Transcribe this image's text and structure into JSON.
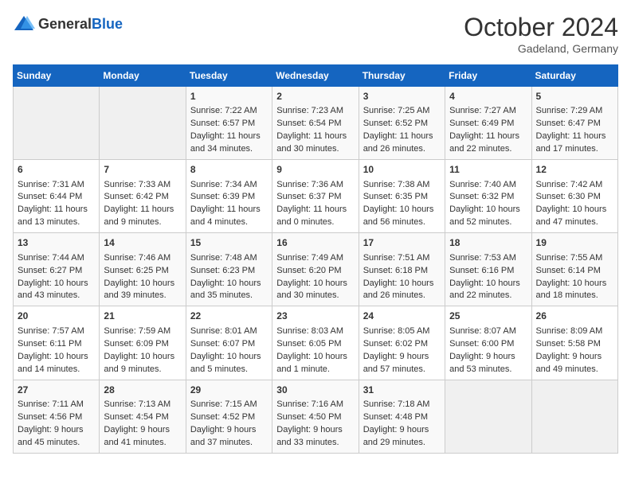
{
  "header": {
    "logo_general": "General",
    "logo_blue": "Blue",
    "month": "October 2024",
    "location": "Gadeland, Germany"
  },
  "weekdays": [
    "Sunday",
    "Monday",
    "Tuesday",
    "Wednesday",
    "Thursday",
    "Friday",
    "Saturday"
  ],
  "weeks": [
    [
      {
        "day": "",
        "empty": true
      },
      {
        "day": "",
        "empty": true
      },
      {
        "day": "1",
        "sunrise": "Sunrise: 7:22 AM",
        "sunset": "Sunset: 6:57 PM",
        "daylight": "Daylight: 11 hours and 34 minutes."
      },
      {
        "day": "2",
        "sunrise": "Sunrise: 7:23 AM",
        "sunset": "Sunset: 6:54 PM",
        "daylight": "Daylight: 11 hours and 30 minutes."
      },
      {
        "day": "3",
        "sunrise": "Sunrise: 7:25 AM",
        "sunset": "Sunset: 6:52 PM",
        "daylight": "Daylight: 11 hours and 26 minutes."
      },
      {
        "day": "4",
        "sunrise": "Sunrise: 7:27 AM",
        "sunset": "Sunset: 6:49 PM",
        "daylight": "Daylight: 11 hours and 22 minutes."
      },
      {
        "day": "5",
        "sunrise": "Sunrise: 7:29 AM",
        "sunset": "Sunset: 6:47 PM",
        "daylight": "Daylight: 11 hours and 17 minutes."
      }
    ],
    [
      {
        "day": "6",
        "sunrise": "Sunrise: 7:31 AM",
        "sunset": "Sunset: 6:44 PM",
        "daylight": "Daylight: 11 hours and 13 minutes."
      },
      {
        "day": "7",
        "sunrise": "Sunrise: 7:33 AM",
        "sunset": "Sunset: 6:42 PM",
        "daylight": "Daylight: 11 hours and 9 minutes."
      },
      {
        "day": "8",
        "sunrise": "Sunrise: 7:34 AM",
        "sunset": "Sunset: 6:39 PM",
        "daylight": "Daylight: 11 hours and 4 minutes."
      },
      {
        "day": "9",
        "sunrise": "Sunrise: 7:36 AM",
        "sunset": "Sunset: 6:37 PM",
        "daylight": "Daylight: 11 hours and 0 minutes."
      },
      {
        "day": "10",
        "sunrise": "Sunrise: 7:38 AM",
        "sunset": "Sunset: 6:35 PM",
        "daylight": "Daylight: 10 hours and 56 minutes."
      },
      {
        "day": "11",
        "sunrise": "Sunrise: 7:40 AM",
        "sunset": "Sunset: 6:32 PM",
        "daylight": "Daylight: 10 hours and 52 minutes."
      },
      {
        "day": "12",
        "sunrise": "Sunrise: 7:42 AM",
        "sunset": "Sunset: 6:30 PM",
        "daylight": "Daylight: 10 hours and 47 minutes."
      }
    ],
    [
      {
        "day": "13",
        "sunrise": "Sunrise: 7:44 AM",
        "sunset": "Sunset: 6:27 PM",
        "daylight": "Daylight: 10 hours and 43 minutes."
      },
      {
        "day": "14",
        "sunrise": "Sunrise: 7:46 AM",
        "sunset": "Sunset: 6:25 PM",
        "daylight": "Daylight: 10 hours and 39 minutes."
      },
      {
        "day": "15",
        "sunrise": "Sunrise: 7:48 AM",
        "sunset": "Sunset: 6:23 PM",
        "daylight": "Daylight: 10 hours and 35 minutes."
      },
      {
        "day": "16",
        "sunrise": "Sunrise: 7:49 AM",
        "sunset": "Sunset: 6:20 PM",
        "daylight": "Daylight: 10 hours and 30 minutes."
      },
      {
        "day": "17",
        "sunrise": "Sunrise: 7:51 AM",
        "sunset": "Sunset: 6:18 PM",
        "daylight": "Daylight: 10 hours and 26 minutes."
      },
      {
        "day": "18",
        "sunrise": "Sunrise: 7:53 AM",
        "sunset": "Sunset: 6:16 PM",
        "daylight": "Daylight: 10 hours and 22 minutes."
      },
      {
        "day": "19",
        "sunrise": "Sunrise: 7:55 AM",
        "sunset": "Sunset: 6:14 PM",
        "daylight": "Daylight: 10 hours and 18 minutes."
      }
    ],
    [
      {
        "day": "20",
        "sunrise": "Sunrise: 7:57 AM",
        "sunset": "Sunset: 6:11 PM",
        "daylight": "Daylight: 10 hours and 14 minutes."
      },
      {
        "day": "21",
        "sunrise": "Sunrise: 7:59 AM",
        "sunset": "Sunset: 6:09 PM",
        "daylight": "Daylight: 10 hours and 9 minutes."
      },
      {
        "day": "22",
        "sunrise": "Sunrise: 8:01 AM",
        "sunset": "Sunset: 6:07 PM",
        "daylight": "Daylight: 10 hours and 5 minutes."
      },
      {
        "day": "23",
        "sunrise": "Sunrise: 8:03 AM",
        "sunset": "Sunset: 6:05 PM",
        "daylight": "Daylight: 10 hours and 1 minute."
      },
      {
        "day": "24",
        "sunrise": "Sunrise: 8:05 AM",
        "sunset": "Sunset: 6:02 PM",
        "daylight": "Daylight: 9 hours and 57 minutes."
      },
      {
        "day": "25",
        "sunrise": "Sunrise: 8:07 AM",
        "sunset": "Sunset: 6:00 PM",
        "daylight": "Daylight: 9 hours and 53 minutes."
      },
      {
        "day": "26",
        "sunrise": "Sunrise: 8:09 AM",
        "sunset": "Sunset: 5:58 PM",
        "daylight": "Daylight: 9 hours and 49 minutes."
      }
    ],
    [
      {
        "day": "27",
        "sunrise": "Sunrise: 7:11 AM",
        "sunset": "Sunset: 4:56 PM",
        "daylight": "Daylight: 9 hours and 45 minutes."
      },
      {
        "day": "28",
        "sunrise": "Sunrise: 7:13 AM",
        "sunset": "Sunset: 4:54 PM",
        "daylight": "Daylight: 9 hours and 41 minutes."
      },
      {
        "day": "29",
        "sunrise": "Sunrise: 7:15 AM",
        "sunset": "Sunset: 4:52 PM",
        "daylight": "Daylight: 9 hours and 37 minutes."
      },
      {
        "day": "30",
        "sunrise": "Sunrise: 7:16 AM",
        "sunset": "Sunset: 4:50 PM",
        "daylight": "Daylight: 9 hours and 33 minutes."
      },
      {
        "day": "31",
        "sunrise": "Sunrise: 7:18 AM",
        "sunset": "Sunset: 4:48 PM",
        "daylight": "Daylight: 9 hours and 29 minutes."
      },
      {
        "day": "",
        "empty": true
      },
      {
        "day": "",
        "empty": true
      }
    ]
  ]
}
